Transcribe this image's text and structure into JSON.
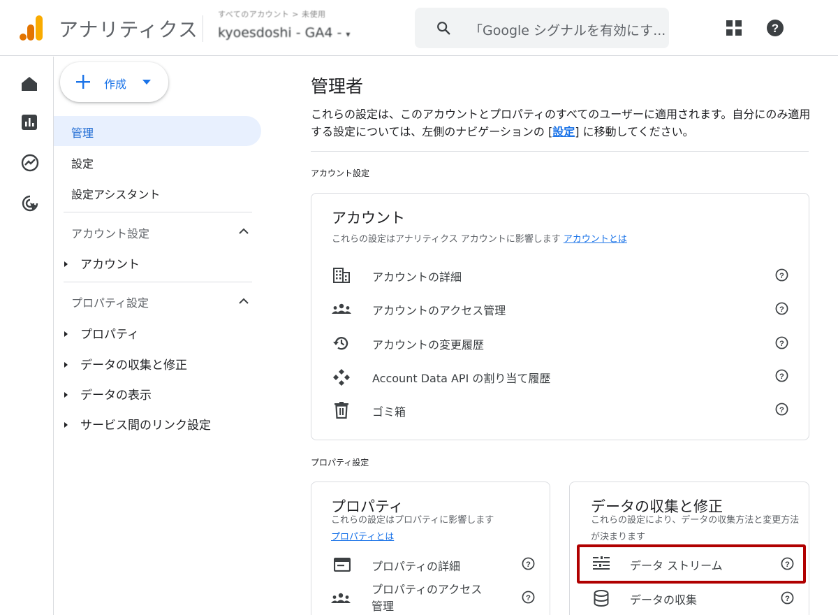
{
  "header": {
    "app_title": "アナリティクス",
    "account_breadcrumb": "すべてのアカウント > 未使用",
    "account_name": "kyoesdoshi - GA4 -",
    "search_placeholder": "「Google シグナルを有効にす..."
  },
  "sidebar": {
    "create_label": "作成",
    "items": [
      {
        "label": "管理",
        "active": true
      },
      {
        "label": "設定"
      },
      {
        "label": "設定アシスタント"
      }
    ],
    "account_section": {
      "label": "アカウント設定",
      "children": [
        "アカウント"
      ]
    },
    "property_section": {
      "label": "プロパティ設定",
      "children": [
        "プロパティ",
        "データの収集と修正",
        "データの表示",
        "サービス間のリンク設定"
      ]
    }
  },
  "main": {
    "title": "管理者",
    "desc_prefix": "これらの設定は、このアカウントとプロパティのすべてのユーザーに適用されます。自分にのみ適用する設定については、左側のナビゲーションの [",
    "desc_link": "設定",
    "desc_suffix": "] に移動してください。",
    "account_settings_label": "アカウント設定",
    "property_settings_label": "プロパティ設定",
    "account_card": {
      "title": "アカウント",
      "subtitle": "これらの設定はアナリティクス アカウントに影響します",
      "link": "アカウントとは",
      "rows": [
        "アカウントの詳細",
        "アカウントのアクセス管理",
        "アカウントの変更履歴",
        "Account Data API の割り当て履歴",
        "ゴミ箱"
      ]
    },
    "property_card": {
      "title": "プロパティ",
      "subtitle": "これらの設定はプロパティに影響します",
      "link": "プロパティとは",
      "rows": [
        "プロパティの詳細",
        "プロパティのアクセス\n管理"
      ]
    },
    "data_card": {
      "title": "データの収集と修正",
      "subtitle": "これらの設定により、データの収集方法と変更方法が決まります",
      "rows": [
        "データ ストリーム",
        "データの収集"
      ]
    }
  },
  "colors": {
    "accent": "#1a73e8",
    "active_bg": "#e8f0fe",
    "highlight": "#b00000",
    "logo_orange": "#f9ab00",
    "logo_dark_orange": "#e37400"
  }
}
